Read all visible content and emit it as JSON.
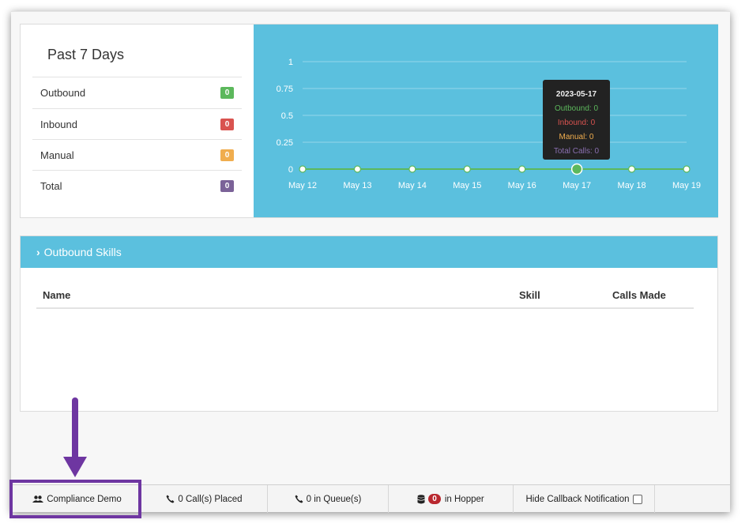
{
  "summary": {
    "title": "Past 7 Days",
    "rows": [
      {
        "label": "Outbound",
        "count": "0",
        "color": "#5cb85c"
      },
      {
        "label": "Inbound",
        "count": "0",
        "color": "#d9534f"
      },
      {
        "label": "Manual",
        "count": "0",
        "color": "#f0ad4e"
      },
      {
        "label": "Total",
        "count": "0",
        "color": "#7b6298"
      }
    ]
  },
  "chart_data": {
    "type": "line",
    "x": [
      "May 12",
      "May 13",
      "May 14",
      "May 15",
      "May 16",
      "May 17",
      "May 18",
      "May 19"
    ],
    "yticks": [
      "1",
      "0.75",
      "0.5",
      "0.25",
      "0"
    ],
    "ylim": [
      0,
      1
    ],
    "series": [
      {
        "values": [
          0,
          0,
          0,
          0,
          0,
          0,
          0,
          0
        ],
        "color": "#5cb85c"
      }
    ],
    "highlighted_index": 5,
    "grid": true,
    "tooltip": {
      "date": "2023-05-17",
      "lines": [
        {
          "text": "Outbound: 0",
          "color": "#5cb85c"
        },
        {
          "text": "Inbound: 0",
          "color": "#d9534f"
        },
        {
          "text": "Manual: 0",
          "color": "#f0ad4e"
        },
        {
          "text": "Total Calls: 0",
          "color": "#8a6fb0"
        }
      ]
    }
  },
  "skills": {
    "header": "Outbound Skills",
    "columns": {
      "name": "Name",
      "skill": "Skill",
      "calls": "Calls Made"
    }
  },
  "statusbar": {
    "campaign": "Compliance Demo",
    "calls_placed": "0 Call(s) Placed",
    "in_queue": "0 in Queue(s)",
    "hopper_count": "0",
    "hopper_label": "in Hopper",
    "hide_callback": "Hide Callback Notification"
  },
  "annotation": {
    "color": "#6e36a1"
  }
}
